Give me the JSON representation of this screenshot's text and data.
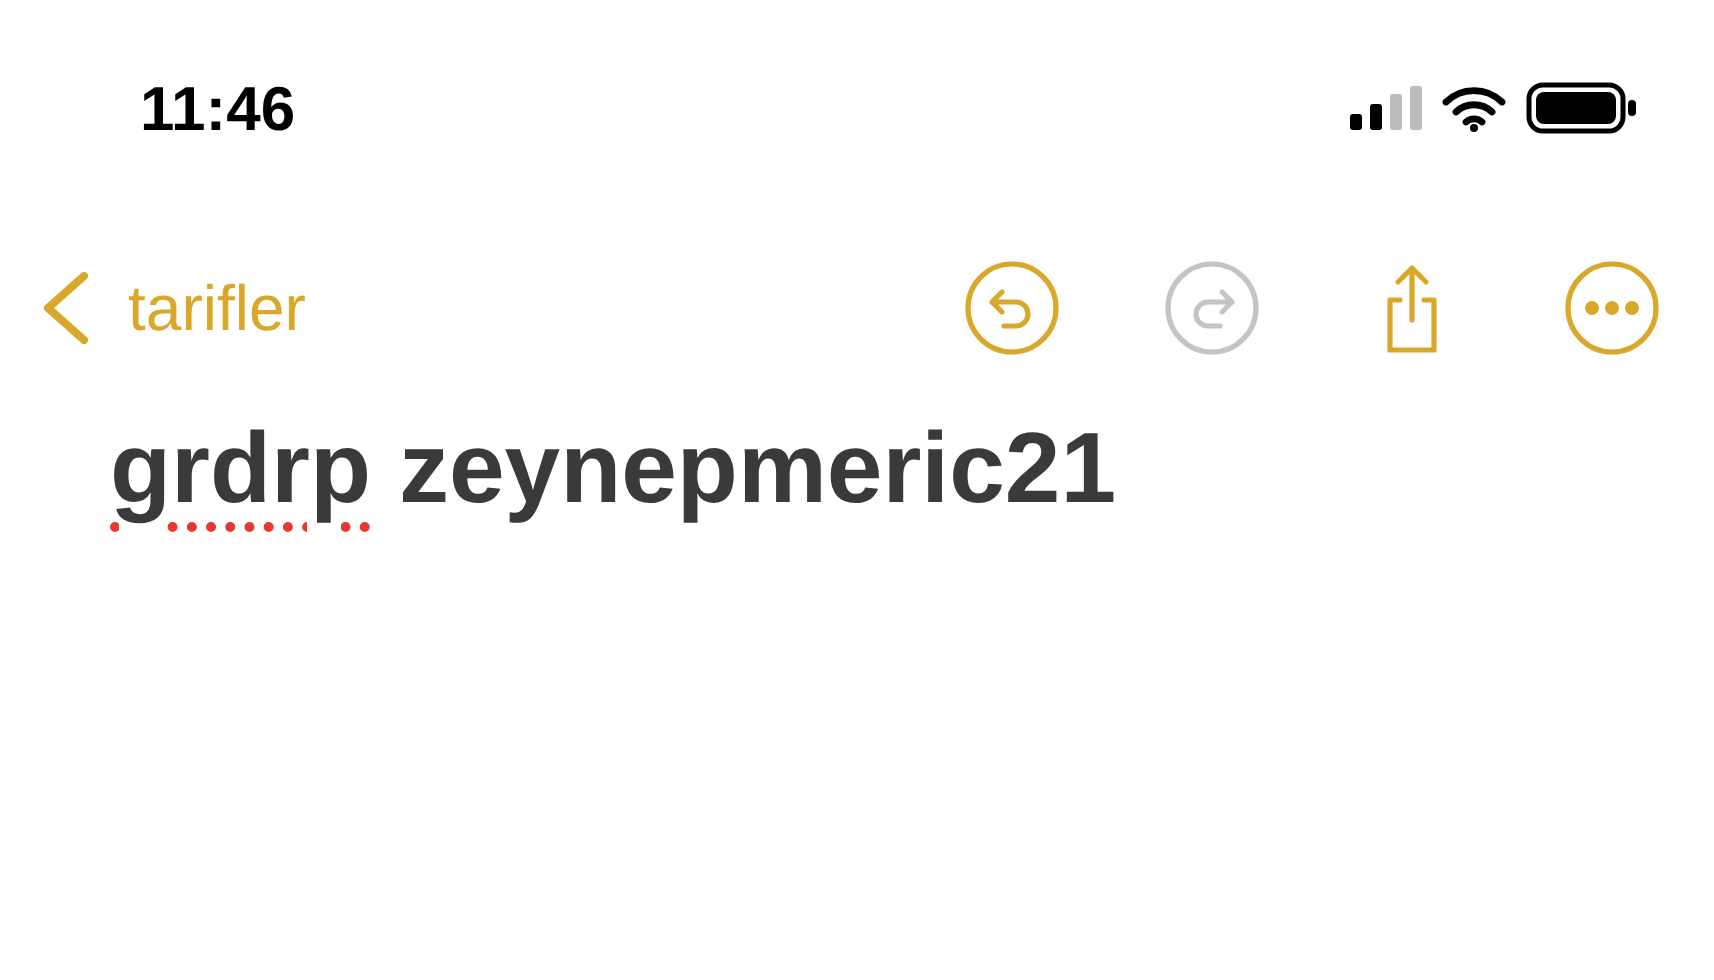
{
  "status_bar": {
    "time": "11:46"
  },
  "nav": {
    "back_label": "tarifler",
    "actions": [
      {
        "kind": "undo",
        "disabled": false
      },
      {
        "kind": "redo",
        "disabled": true
      },
      {
        "kind": "share",
        "disabled": false
      },
      {
        "kind": "more",
        "disabled": false
      }
    ]
  },
  "note": {
    "title_words": [
      {
        "text": "grdrp",
        "misspelled": true
      },
      {
        "text": "zeynepmeric21",
        "misspelled": false
      }
    ]
  }
}
